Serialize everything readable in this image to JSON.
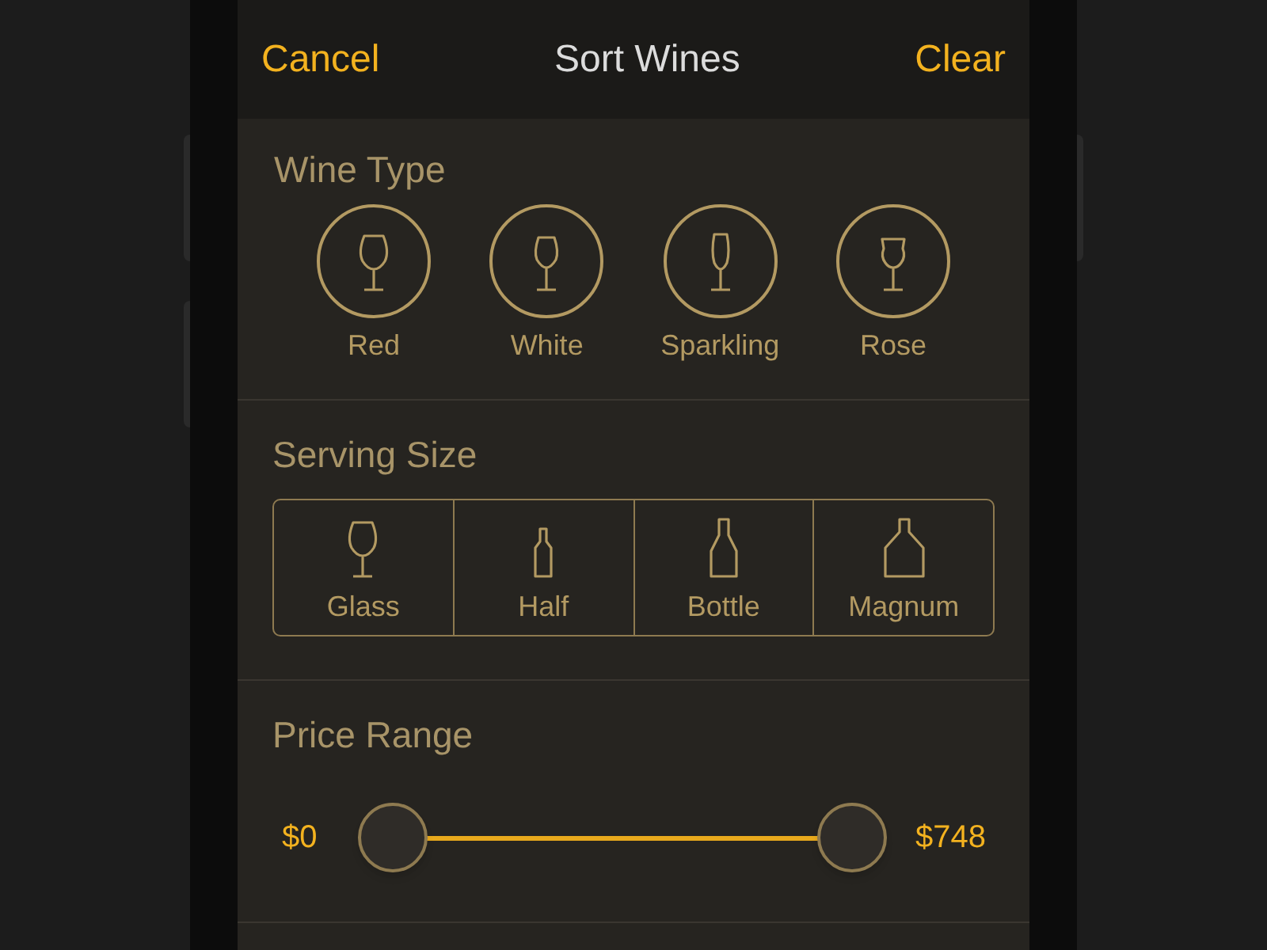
{
  "nav": {
    "cancel": "Cancel",
    "title": "Sort Wines",
    "clear": "Clear"
  },
  "wine_type": {
    "title": "Wine Type",
    "items": [
      {
        "label": "Red",
        "kind": "red",
        "selected": false
      },
      {
        "label": "White",
        "kind": "white",
        "selected": false
      },
      {
        "label": "Sparkling",
        "kind": "sparkling",
        "selected": false
      },
      {
        "label": "Rose",
        "kind": "rose",
        "selected": false
      }
    ]
  },
  "serving_size": {
    "title": "Serving Size",
    "items": [
      {
        "label": "Glass",
        "kind": "glass",
        "selected": false
      },
      {
        "label": "Half",
        "kind": "half",
        "selected": false
      },
      {
        "label": "Bottle",
        "kind": "bottle",
        "selected": false
      },
      {
        "label": "Magnum",
        "kind": "magnum",
        "selected": false
      }
    ]
  },
  "price_range": {
    "title": "Price Range",
    "min_label": "$0",
    "max_label": "$748",
    "low": {
      "level": 0
    },
    "high": {
      "level": 1
    }
  }
}
